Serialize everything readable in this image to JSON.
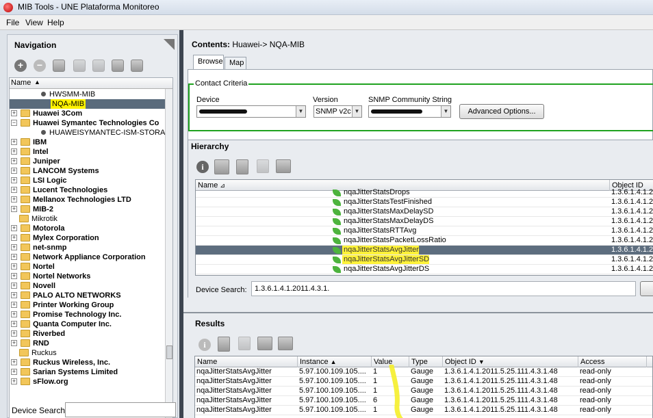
{
  "window": {
    "title": "MIB Tools - UNE Plataforma Monitoreo"
  },
  "menu": {
    "file": "File",
    "view": "View",
    "help": "Help"
  },
  "navigation": {
    "title": "Navigation",
    "column_name": "Name",
    "device_search_label": "Device Search:",
    "tree": [
      {
        "label": "HWSMM-MIB",
        "type": "leaf",
        "indent": 46,
        "bold": false
      },
      {
        "label": "NQA-MIB",
        "type": "leaf-selected",
        "indent": 60,
        "bold": false
      },
      {
        "label": "Huawei 3Com",
        "type": "folder",
        "expand": "+",
        "bold": true
      },
      {
        "label": "Huawei Symantec Technologies Co",
        "type": "folder",
        "expand": "-",
        "bold": true
      },
      {
        "label": "HUAWEISYMANTEC-ISM-STORAGE-SV",
        "type": "leaf",
        "indent": 46,
        "bold": false
      },
      {
        "label": "IBM",
        "type": "folder",
        "expand": "+",
        "bold": true
      },
      {
        "label": "Intel",
        "type": "folder",
        "expand": "+",
        "bold": true
      },
      {
        "label": "Juniper",
        "type": "folder",
        "expand": "+",
        "bold": true
      },
      {
        "label": "LANCOM Systems",
        "type": "folder",
        "expand": "+",
        "bold": true
      },
      {
        "label": "LSI Logic",
        "type": "folder",
        "expand": "+",
        "bold": true
      },
      {
        "label": "Lucent Technologies",
        "type": "folder",
        "expand": "+",
        "bold": true
      },
      {
        "label": "Mellanox Technologies LTD",
        "type": "folder",
        "expand": "+",
        "bold": true
      },
      {
        "label": "MIB-2",
        "type": "folder",
        "expand": "+",
        "bold": true
      },
      {
        "label": "Mikrotik",
        "type": "folder-open",
        "expand": "",
        "bold": false
      },
      {
        "label": "Motorola",
        "type": "folder",
        "expand": "+",
        "bold": true
      },
      {
        "label": "Mylex Corporation",
        "type": "folder",
        "expand": "+",
        "bold": true
      },
      {
        "label": "net-snmp",
        "type": "folder",
        "expand": "+",
        "bold": true
      },
      {
        "label": "Network Appliance Corporation",
        "type": "folder",
        "expand": "+",
        "bold": true
      },
      {
        "label": "Nortel",
        "type": "folder",
        "expand": "+",
        "bold": true
      },
      {
        "label": "Nortel Networks",
        "type": "folder",
        "expand": "+",
        "bold": true
      },
      {
        "label": "Novell",
        "type": "folder",
        "expand": "+",
        "bold": true
      },
      {
        "label": "PALO ALTO NETWORKS",
        "type": "folder",
        "expand": "+",
        "bold": true
      },
      {
        "label": "Printer Working Group",
        "type": "folder",
        "expand": "+",
        "bold": true
      },
      {
        "label": "Promise Technology Inc.",
        "type": "folder",
        "expand": "+",
        "bold": true
      },
      {
        "label": "Quanta Computer Inc.",
        "type": "folder",
        "expand": "+",
        "bold": true
      },
      {
        "label": "Riverbed",
        "type": "folder",
        "expand": "+",
        "bold": true
      },
      {
        "label": "RND",
        "type": "folder",
        "expand": "+",
        "bold": true
      },
      {
        "label": "Ruckus",
        "type": "folder-open",
        "expand": "",
        "bold": false
      },
      {
        "label": "Ruckus Wireless, Inc.",
        "type": "folder",
        "expand": "+",
        "bold": true
      },
      {
        "label": "Sarian Systems Limited",
        "type": "folder",
        "expand": "+",
        "bold": true
      },
      {
        "label": "sFlow.org",
        "type": "folder",
        "expand": "+",
        "bold": true
      }
    ]
  },
  "contents": {
    "label": "Contents:",
    "path": "Huawei-> NQA-MIB",
    "tabs": [
      "Browse",
      "Map"
    ],
    "criteria": {
      "legend": "Contact Criteria",
      "device_label": "Device",
      "version_label": "Version",
      "version_value": "SNMP v2c",
      "community_label": "SNMP Community String",
      "advanced_button": "Advanced Options..."
    },
    "hierarchy": {
      "title": "Hierarchy",
      "col_name": "Name",
      "col_oid": "Object ID",
      "rows": [
        {
          "name": "nqaJitterStatsDrops",
          "oid": "1.3.6.1.4.1.2",
          "selected": false,
          "highlight": false
        },
        {
          "name": "nqaJitterStatsTestFinished",
          "oid": "1.3.6.1.4.1.2",
          "selected": false,
          "highlight": false
        },
        {
          "name": "nqaJitterStatsMaxDelaySD",
          "oid": "1.3.6.1.4.1.2",
          "selected": false,
          "highlight": false
        },
        {
          "name": "nqaJitterStatsMaxDelayDS",
          "oid": "1.3.6.1.4.1.2",
          "selected": false,
          "highlight": false
        },
        {
          "name": "nqaJitterStatsRTTAvg",
          "oid": "1.3.6.1.4.1.2",
          "selected": false,
          "highlight": false
        },
        {
          "name": "nqaJitterStatsPacketLossRatio",
          "oid": "1.3.6.1.4.1.2",
          "selected": false,
          "highlight": false
        },
        {
          "name": "nqaJitterStatsAvgJitter",
          "oid": "1.3.6.1.4.1.2",
          "selected": true,
          "highlight": true
        },
        {
          "name": "nqaJitterStatsAvgJitterSD",
          "oid": "1.3.6.1.4.1.2",
          "selected": false,
          "highlight": true
        },
        {
          "name": "nqaJitterStatsAvgJitterDS",
          "oid": "1.3.6.1.4.1.2",
          "selected": false,
          "highlight": false
        }
      ],
      "device_search_label": "Device Search:",
      "device_search_value": "1.3.6.1.4.1.2011.4.3.1."
    },
    "results": {
      "title": "Results",
      "columns": [
        "Name",
        "Instance",
        "Value",
        "Type",
        "Object ID",
        "Access"
      ],
      "rows": [
        [
          "nqaJitterStatsAvgJitter",
          "5.97.100.109.105....",
          "1",
          "Gauge",
          "1.3.6.1.4.1.2011.5.25.111.4.3.1.48",
          "read-only"
        ],
        [
          "nqaJitterStatsAvgJitter",
          "5.97.100.109.105....",
          "1",
          "Gauge",
          "1.3.6.1.4.1.2011.5.25.111.4.3.1.48",
          "read-only"
        ],
        [
          "nqaJitterStatsAvgJitter",
          "5.97.100.109.105....",
          "1",
          "Gauge",
          "1.3.6.1.4.1.2011.5.25.111.4.3.1.48",
          "read-only"
        ],
        [
          "nqaJitterStatsAvgJitter",
          "5.97.100.109.105....",
          "6",
          "Gauge",
          "1.3.6.1.4.1.2011.5.25.111.4.3.1.48",
          "read-only"
        ],
        [
          "nqaJitterStatsAvgJitter",
          "5.97.100.109.105....",
          "1",
          "Gauge",
          "1.3.6.1.4.1.2011.5.25.111.4.3.1.48",
          "read-only"
        ]
      ]
    }
  },
  "colors": {
    "accent_green": "#1fa21f",
    "highlight_yellow": "#fff200",
    "selection": "#5a6b7c"
  }
}
